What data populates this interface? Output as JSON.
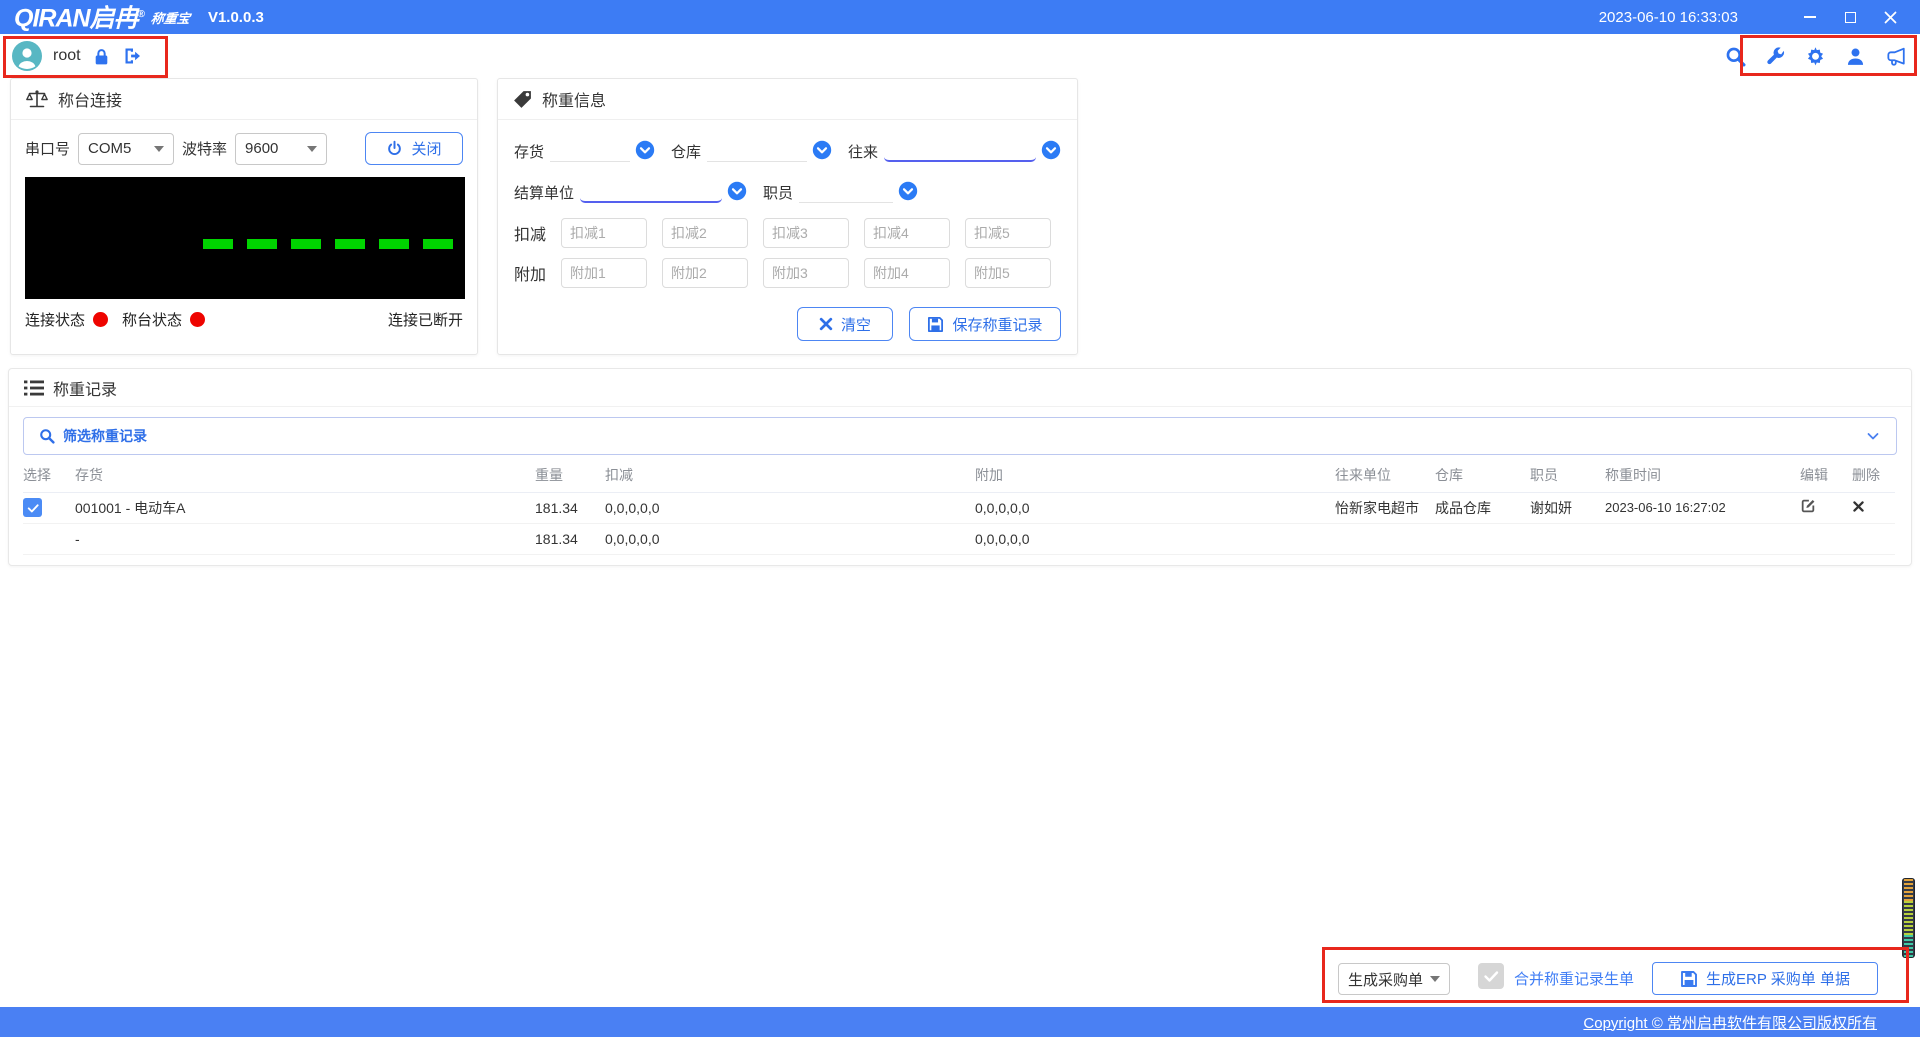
{
  "title_bar": {
    "brand": "QIRAN启冉",
    "reg": "®",
    "product": "称重宝",
    "version": "V1.0.0.3",
    "datetime": "2023-06-10 16:33:03"
  },
  "user_bar": {
    "username": "root"
  },
  "scale_panel": {
    "title": "称台连接",
    "port_label": "串口号",
    "port_value": "COM5",
    "baud_label": "波特率",
    "baud_value": "9600",
    "close_button": "关闭",
    "conn_label": "连接状态",
    "scale_label": "称台状态",
    "conn_status": "连接已断开",
    "led_color": "#00d400",
    "status_color": "#ee0400"
  },
  "weigh_panel": {
    "title": "称重信息",
    "inventory_label": "存货",
    "warehouse_label": "仓库",
    "partner_label": "往来",
    "settle_label": "结算单位",
    "staff_label": "职员",
    "deduct_label": "扣减",
    "deduct_placeholders": [
      "扣减1",
      "扣减2",
      "扣减3",
      "扣减4",
      "扣减5"
    ],
    "extra_label": "附加",
    "extra_placeholders": [
      "附加1",
      "附加2",
      "附加3",
      "附加4",
      "附加5"
    ],
    "clear_button": "清空",
    "save_button": "保存称重记录"
  },
  "records": {
    "title": "称重记录",
    "filter_label": "筛选称重记录",
    "columns": [
      "选择",
      "存货",
      "重量",
      "扣减",
      "附加",
      "往来单位",
      "仓库",
      "职员",
      "称重时间",
      "编辑",
      "删除"
    ],
    "rows": [
      {
        "inventory": "001001 - 电动车A",
        "weight": "181.34",
        "deduct": "0,0,0,0,0",
        "extra": "0,0,0,0,0",
        "partner": "怡新家电超市",
        "warehouse": "成品仓库",
        "staff": "谢如妍",
        "time": "2023-06-10 16:27:02"
      },
      {
        "inventory": "-",
        "weight": "181.34",
        "deduct": "0,0,0,0,0",
        "extra": "0,0,0,0,0",
        "partner": "",
        "warehouse": "",
        "staff": "",
        "time": ""
      }
    ]
  },
  "bottom_bar": {
    "doc_type": "生成采购单",
    "merge_label": "合并称重记录生单",
    "generate_button": "生成ERP 采购单 单据"
  },
  "footer": {
    "copyright": "Copyright © 常州启冉软件有限公司版权所有"
  },
  "colors": {
    "accent": "#2e72ef",
    "titlebar": "#3d7cf4",
    "annotation": "#e8281d"
  }
}
